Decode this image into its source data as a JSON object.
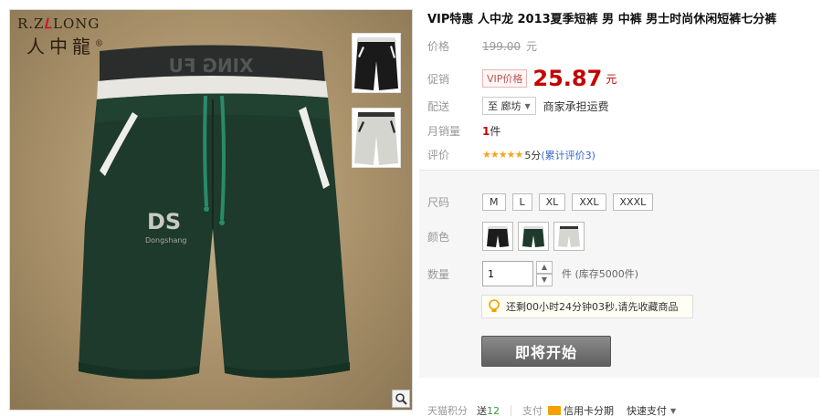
{
  "product": {
    "title": "VIP特惠 人中龙 2013夏季短裤 男 中裤 男士时尚休闲短裤七分裤",
    "brand_logo": {
      "latin_left": "R.Z",
      "latin_right": "LONG",
      "chinese": "人中龍",
      "registered": "®"
    },
    "waistband_text": "XING FU",
    "leg_print": {
      "mark": "DS",
      "sub": "Dongshang"
    }
  },
  "price": {
    "label": "价格",
    "original": "199.00",
    "currency": "元"
  },
  "promo": {
    "label": "促销",
    "badge": "VIP价格",
    "price": "25.87",
    "currency": "元"
  },
  "shipping": {
    "label": "配送",
    "location": "至 廊坊",
    "note": "商家承担运费",
    "icon": "chevron-down-icon"
  },
  "monthly_sales": {
    "label": "月销量",
    "count": "1",
    "unit": "件"
  },
  "rating": {
    "label": "评价",
    "stars": "★★★★★",
    "score": "5分",
    "link": "(累计评价3)"
  },
  "spec": {
    "size_label": "尺码",
    "sizes": [
      "M",
      "L",
      "XL",
      "XXL",
      "XXXL"
    ],
    "color_label": "颜色",
    "colors": [
      "#1c1c1c",
      "#1e3a2c",
      "#d6d6d0"
    ],
    "qty_label": "数量",
    "qty_value": "1",
    "qty_up": "▲",
    "qty_down": "▼",
    "stock_unit": "件",
    "stock_text": "(库存5000件)",
    "tip_icon": "lightbulb-icon",
    "tip_text": "还剩00小时24分钟03秒,请先收藏商品",
    "buy_label": "即将开始"
  },
  "footer": {
    "points_label": "天猫积分",
    "points_prefix": "送",
    "points_value": "12",
    "pay_label": "支付",
    "credit_label": "信用卡分期",
    "quick_label": "快速支付"
  },
  "colors": {
    "price_red": "#c40000",
    "accent_orange": "#f2a100",
    "link_blue": "#3366cc"
  }
}
